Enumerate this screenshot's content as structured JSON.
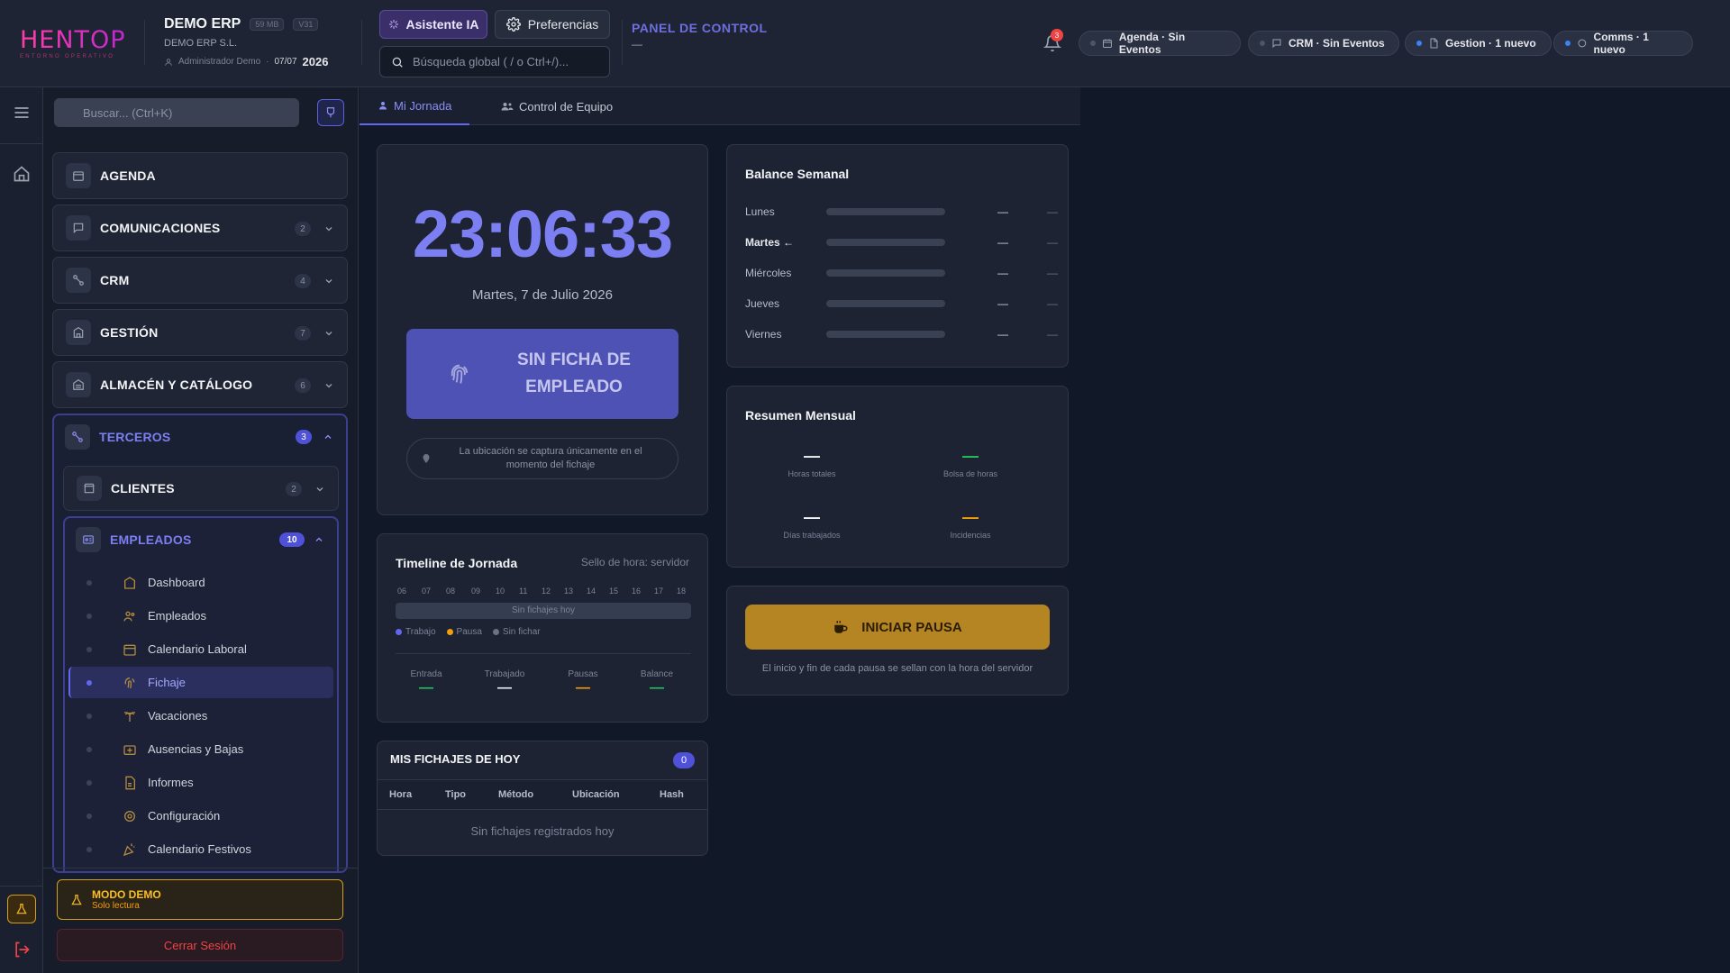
{
  "header": {
    "logo_text": "HENTOP",
    "logo_sub": "ENTORNO OPERATIVO",
    "company_name": "DEMO ERP",
    "size_chip": "59 MB",
    "version_chip": "V31",
    "company_sub": "DEMO ERP S.L.",
    "user": "Administrador Demo",
    "date_short": "07/07",
    "year": "2026",
    "ai_button": "Asistente IA",
    "prefs_button": "Preferencias",
    "search_placeholder": "Búsqueda global ( / o Ctrl+/)...",
    "panel_title": "PANEL DE CONTROL",
    "panel_sub": "—",
    "notif_count": "3",
    "pills": [
      {
        "label": "Agenda · Sin Eventos",
        "dot": "gray"
      },
      {
        "label": "CRM · Sin Eventos",
        "dot": "gray"
      },
      {
        "label": "Gestion · 1 nuevo",
        "dot": "blue"
      },
      {
        "label": "Comms · 1 nuevo",
        "dot": "blue"
      }
    ]
  },
  "sidebar": {
    "search_placeholder": "Buscar... (Ctrl+K)",
    "groups": [
      {
        "label": "AGENDA",
        "count": ""
      },
      {
        "label": "COMUNICACIONES",
        "count": "2"
      },
      {
        "label": "CRM",
        "count": "4"
      },
      {
        "label": "GESTIÓN",
        "count": "7"
      },
      {
        "label": "ALMACÉN Y CATÁLOGO",
        "count": "6"
      }
    ],
    "terceros": {
      "label": "TERCEROS",
      "count": "3"
    },
    "clientes": {
      "label": "CLIENTES",
      "count": "2"
    },
    "empleados": {
      "label": "EMPLEADOS",
      "count": "10"
    },
    "empleados_items": [
      "Dashboard",
      "Empleados",
      "Calendario Laboral",
      "Fichaje",
      "Vacaciones",
      "Ausencias y Bajas",
      "Informes",
      "Configuración",
      "Calendario Festivos"
    ],
    "active_item": "Fichaje",
    "demo_title": "MODO DEMO",
    "demo_sub": "Solo lectura",
    "logout": "Cerrar Sesión"
  },
  "tabs": [
    {
      "label": "Mi Jornada",
      "active": true
    },
    {
      "label": "Control de Equipo",
      "active": false
    }
  ],
  "clock": {
    "time": "23:06:33",
    "date": "Martes, 7 de Julio 2026",
    "button": "SIN FICHA DE EMPLEADO",
    "location_note": "La ubicación se captura únicamente en el momento del fichaje"
  },
  "balance": {
    "title": "Balance Semanal",
    "rows": [
      {
        "day": "Lunes",
        "v1": "—",
        "v2": "—"
      },
      {
        "day": "Martes ←",
        "v1": "—",
        "v2": "—"
      },
      {
        "day": "Miércoles",
        "v1": "—",
        "v2": "—"
      },
      {
        "day": "Jueves",
        "v1": "—",
        "v2": "—"
      },
      {
        "day": "Viernes",
        "v1": "—",
        "v2": "—"
      }
    ]
  },
  "resumen": {
    "title": "Resumen Mensual",
    "cells": [
      {
        "value": "—",
        "label": "Horas totales",
        "color": "#f3f4f6"
      },
      {
        "value": "—",
        "label": "Bolsa de horas",
        "color": "#22c55e"
      },
      {
        "value": "—",
        "label": "Días trabajados",
        "color": "#f3f4f6"
      },
      {
        "value": "—",
        "label": "Incidencias",
        "color": "#f59e0b"
      }
    ]
  },
  "pausa": {
    "button": "INICIAR PAUSA",
    "note": "El inicio y fin de cada pausa se sellan con la hora del servidor"
  },
  "timeline": {
    "title": "Timeline de Jornada",
    "sello": "Sello de hora: servidor",
    "hours": [
      "06",
      "07",
      "08",
      "09",
      "10",
      "11",
      "12",
      "13",
      "14",
      "15",
      "16",
      "17",
      "18"
    ],
    "bar_text": "Sin fichajes hoy",
    "legend": [
      {
        "label": "Trabajo",
        "color": "#6366f1"
      },
      {
        "label": "Pausa",
        "color": "#f59e0b"
      },
      {
        "label": "Sin fichar",
        "color": "#6b7280"
      }
    ],
    "stats": [
      {
        "label": "Entrada",
        "value": "—",
        "color": "#22c55e"
      },
      {
        "label": "Trabajado",
        "value": "—",
        "color": "#f3f4f6"
      },
      {
        "label": "Pausas",
        "value": "—",
        "color": "#f59e0b"
      },
      {
        "label": "Balance",
        "value": "—",
        "color": "#22c55e"
      }
    ]
  },
  "fichajes": {
    "title": "MIS FICHAJES DE HOY",
    "count": "0",
    "columns": [
      "Hora",
      "Tipo",
      "Método",
      "Ubicación",
      "Hash"
    ],
    "empty": "Sin fichajes registrados hoy"
  }
}
